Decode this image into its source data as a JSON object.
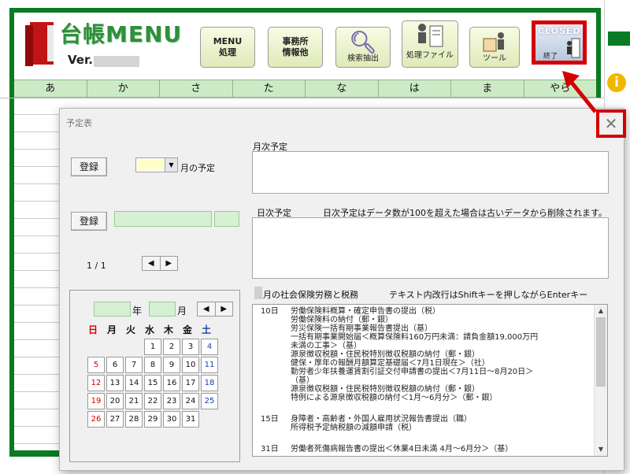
{
  "app": {
    "logo_text": "台帳MENU",
    "version_label": "Ver.",
    "buttons": [
      {
        "line1": "MENU",
        "line2": "処理",
        "caption": ""
      },
      {
        "line1": "事務所",
        "line2": "情報他",
        "caption": ""
      },
      {
        "line1": "",
        "line2": "",
        "caption": "検索抽出"
      },
      {
        "line1": "",
        "line2": "",
        "caption": "処理ファイル"
      },
      {
        "line1": "",
        "line2": "",
        "caption": "ツール"
      }
    ],
    "closed": {
      "label": "CLOSED",
      "caption": "終了"
    },
    "kana_tabs": [
      "あ",
      "か",
      "さ",
      "た",
      "な",
      "は",
      "ま",
      "やら"
    ]
  },
  "dialog": {
    "title": "予定表",
    "close_symbol": "✕",
    "register_label": "登録",
    "month_suffix": "月の予定",
    "monthly_label": "月次予定",
    "daily_label": "日次予定",
    "daily_note": "日次予定はデータ数が100を超えた場合は古いデータから削除されます。",
    "page_indicator": "1 / 1",
    "prev_symbol": "◀",
    "next_symbol": "▶",
    "social_label": "月の社会保険労務と税務",
    "text_note": "テキスト内改行はShiftキーを押しながらEnterキー",
    "calendar": {
      "year_suffix": "年",
      "month_suffix": "月",
      "weekdays": [
        "日",
        "月",
        "火",
        "水",
        "木",
        "金",
        "土"
      ],
      "weeks": [
        [
          "",
          "",
          "",
          "1",
          "2",
          "3",
          "4"
        ],
        [
          "5",
          "6",
          "7",
          "8",
          "9",
          "10",
          "11"
        ],
        [
          "12",
          "13",
          "14",
          "15",
          "16",
          "17",
          "18"
        ],
        [
          "19",
          "20",
          "21",
          "22",
          "23",
          "24",
          "25"
        ],
        [
          "26",
          "27",
          "28",
          "29",
          "30",
          "31",
          ""
        ]
      ]
    },
    "schedule": [
      {
        "day": "10日",
        "lines": [
          "労働保険料概算・確定申告書の提出（税）",
          "労働保険料の納付（郵・銀）",
          "労災保険一括有期事業報告書提出（基）",
          "一括有期事業開始届＜概算保険料160万円未満：請負金額19,000万円",
          "  未満の工事＞（基）",
          "源泉徴収税額・住民税特別徴収税額の納付（郵・銀）",
          "健保・厚年の報酬月額算定基礎届＜7月1日現在＞（社）",
          "勤労者少年扶養運賃割引証交付申請書の提出＜7月11日～8月20日＞",
          "（基）",
          "源泉徴収税額・住民税特別徴収税額の納付（郵・銀）",
          "特例による源泉徴収税額の納付＜1月～6月分＞（郵・銀）"
        ]
      },
      {
        "day": "15日",
        "lines": [
          "身障者・高齢者・外国人雇用状況報告書提出（職）",
          "所得税予定納税額の減額申請（税）"
        ]
      },
      {
        "day": "31日",
        "lines": [
          "労働者死傷病報告書の提出＜休業4日未満  4月～6月分＞（基）"
        ]
      }
    ]
  },
  "colors": {
    "frame_green": "#0b7a24",
    "kana_bg": "#cdeac6",
    "highlight_red": "#d40000",
    "sunday_red": "#d40000",
    "saturday_blue": "#1a3fa8"
  },
  "icons": {
    "logo": "red-book-icon",
    "search": "magnifier-icon",
    "files": "person-files-icon",
    "tools": "toolbox-icon",
    "exit": "exit-person-icon",
    "info": "info-icon",
    "arrow": "red-arrow-icon"
  }
}
